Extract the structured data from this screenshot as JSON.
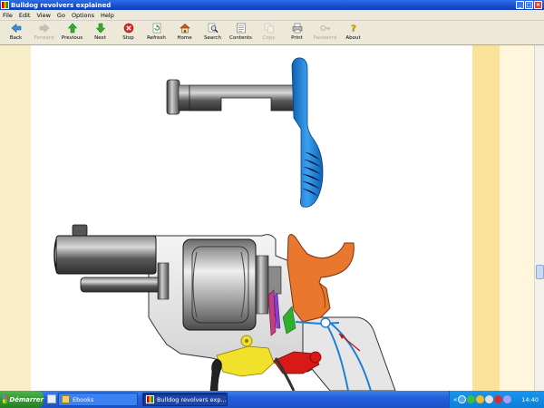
{
  "window": {
    "title": "Bulldog revolvers explained"
  },
  "menu": {
    "items": [
      "File",
      "Edit",
      "View",
      "Go",
      "Options",
      "Help"
    ]
  },
  "toolbar": {
    "buttons": [
      {
        "label": "Back",
        "icon": "back-arrow-icon",
        "enabled": true
      },
      {
        "label": "Forward",
        "icon": "forward-arrow-icon",
        "enabled": false
      },
      {
        "label": "Previous",
        "icon": "up-arrow-icon",
        "enabled": true
      },
      {
        "label": "Next",
        "icon": "down-arrow-icon",
        "enabled": true
      },
      {
        "label": "Stop",
        "icon": "stop-icon",
        "enabled": true
      },
      {
        "label": "Refresh",
        "icon": "refresh-icon",
        "enabled": true
      },
      {
        "label": "Home",
        "icon": "home-icon",
        "enabled": true
      },
      {
        "label": "Search",
        "icon": "search-icon",
        "enabled": true
      },
      {
        "label": "Contents",
        "icon": "contents-icon",
        "enabled": true
      },
      {
        "label": "Copy",
        "icon": "copy-icon",
        "enabled": false
      },
      {
        "label": "Print",
        "icon": "print-icon",
        "enabled": true
      },
      {
        "label": "Password",
        "icon": "key-icon",
        "enabled": false
      },
      {
        "label": "About",
        "icon": "about-icon",
        "enabled": true
      }
    ]
  },
  "colors": {
    "trigger_blue": "#1f7fd6",
    "hammer_orange": "#e9772e",
    "yellow_part": "#f1e12a",
    "red_part": "#d91818",
    "steel_dark": "#3a3a3a",
    "steel_light": "#bfbfbf"
  },
  "taskbar": {
    "start_label": "Démarrer",
    "tasks": [
      {
        "label": "Ebooks",
        "active": false
      },
      {
        "label": "Bulldog revolvers exp...",
        "active": true
      }
    ],
    "clock": "14:40"
  }
}
